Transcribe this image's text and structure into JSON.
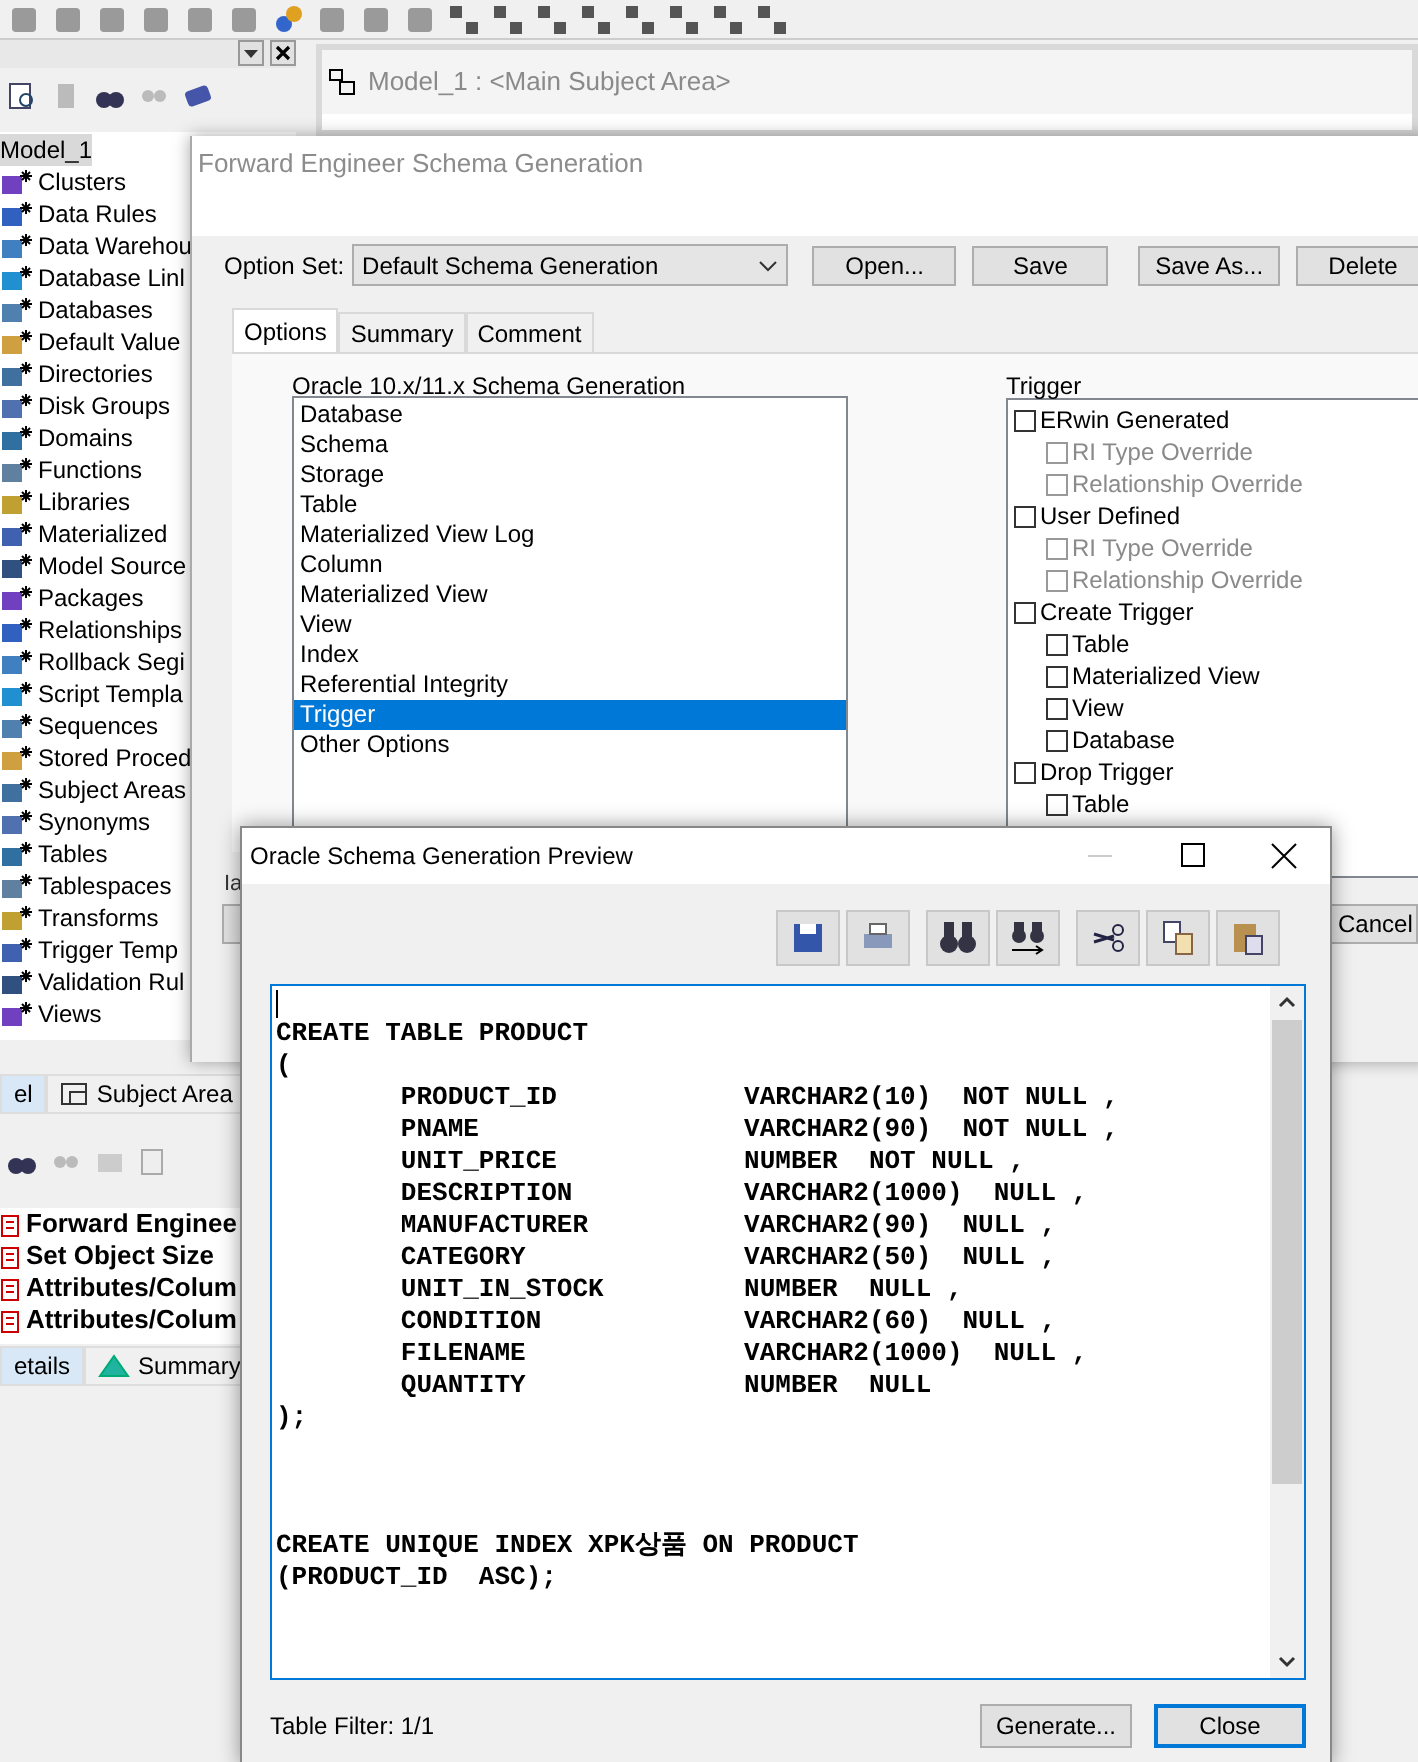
{
  "model_explorer": {
    "root": {
      "label": "Model_1",
      "selected": true
    },
    "items": [
      {
        "label": "Clusters",
        "selected": false
      },
      {
        "label": "Data Rules",
        "selected": false
      },
      {
        "label": "Data Warehou",
        "selected": false
      },
      {
        "label": "Database Linl",
        "selected": false
      },
      {
        "label": "Databases",
        "selected": false
      },
      {
        "label": "Default Value",
        "selected": false
      },
      {
        "label": "Directories",
        "selected": false
      },
      {
        "label": "Disk Groups",
        "selected": false
      },
      {
        "label": "Domains",
        "selected": false
      },
      {
        "label": "Functions",
        "selected": false
      },
      {
        "label": "Libraries",
        "selected": false
      },
      {
        "label": "Materialized",
        "selected": false
      },
      {
        "label": "Model Source",
        "selected": false
      },
      {
        "label": "Packages",
        "selected": false
      },
      {
        "label": "Relationships",
        "selected": false
      },
      {
        "label": "Rollback Segi",
        "selected": false
      },
      {
        "label": "Script Templa",
        "selected": false
      },
      {
        "label": "Sequences",
        "selected": false
      },
      {
        "label": "Stored Proced",
        "selected": false
      },
      {
        "label": "Subject Areas",
        "selected": false
      },
      {
        "label": "Synonyms",
        "selected": false
      },
      {
        "label": "Tables",
        "selected": false
      },
      {
        "label": "Tablespaces",
        "selected": false
      },
      {
        "label": "Transforms",
        "selected": false
      },
      {
        "label": "Trigger Temp",
        "selected": false
      },
      {
        "label": "Validation Rul",
        "selected": false
      },
      {
        "label": "Views",
        "selected": false
      }
    ]
  },
  "model_window": {
    "title": "Model_1 : <Main Subject Area>"
  },
  "explorer_tabs": [
    {
      "label": "el",
      "selected": true
    },
    {
      "label": "Subject Area",
      "selected": false
    }
  ],
  "action_log": {
    "items": [
      "Forward Enginee",
      "Set Object Size",
      "Attributes/Colum",
      "Attributes/Colum"
    ]
  },
  "log_tabs": [
    {
      "label": "etails",
      "selected": true
    },
    {
      "label": "Summary",
      "selected": false
    }
  ],
  "forward_engineer": {
    "title": "Forward Engineer Schema Generation",
    "option_set_label": "Option Set:",
    "option_set": "Default Schema Generation",
    "buttons": [
      "Open...",
      "Save",
      "Save As...",
      "Delete"
    ],
    "tabs": [
      {
        "label": "Options",
        "selected": true
      },
      {
        "label": "Summary",
        "selected": false
      },
      {
        "label": "Comment",
        "selected": false
      }
    ],
    "schema_label": "Oracle 10.x/11.x Schema Generation",
    "categories": [
      {
        "label": "Database",
        "selected": false
      },
      {
        "label": "Schema",
        "selected": false
      },
      {
        "label": "Storage",
        "selected": false
      },
      {
        "label": "Table",
        "selected": false
      },
      {
        "label": "Materialized View Log",
        "selected": false
      },
      {
        "label": "Column",
        "selected": false
      },
      {
        "label": "Materialized View",
        "selected": false
      },
      {
        "label": "View",
        "selected": false
      },
      {
        "label": "Index",
        "selected": false
      },
      {
        "label": "Referential Integrity",
        "selected": false
      },
      {
        "label": "Trigger",
        "selected": true
      },
      {
        "label": "Other Options",
        "selected": false
      }
    ],
    "trigger_label": "Trigger",
    "trigger_options": [
      {
        "label": "ERwin Generated",
        "checked": false,
        "disabled": false,
        "children": [
          {
            "label": "RI Type Override",
            "checked": false,
            "disabled": true
          },
          {
            "label": "Relationship Override",
            "checked": false,
            "disabled": true
          }
        ]
      },
      {
        "label": "User Defined",
        "checked": false,
        "disabled": false,
        "children": [
          {
            "label": "RI Type Override",
            "checked": false,
            "disabled": true
          },
          {
            "label": "Relationship Override",
            "checked": false,
            "disabled": true
          }
        ]
      },
      {
        "label": "Create Trigger",
        "checked": false,
        "disabled": false,
        "children": [
          {
            "label": "Table",
            "checked": false,
            "disabled": false
          },
          {
            "label": "Materialized View",
            "checked": false,
            "disabled": false
          },
          {
            "label": "View",
            "checked": false,
            "disabled": false
          },
          {
            "label": "Database",
            "checked": false,
            "disabled": false
          }
        ]
      },
      {
        "label": "Drop Trigger",
        "checked": false,
        "disabled": false,
        "children": [
          {
            "label": "Table",
            "checked": false,
            "disabled": false
          }
        ]
      }
    ],
    "cut_label": "Ia",
    "cancel": "Cancel"
  },
  "preview": {
    "title": "Oracle Schema Generation Preview",
    "statements": [
      [
        "CREATE TABLE PRODUCT",
        "(",
        "        PRODUCT_ID            VARCHAR2(10)  NOT NULL ,",
        "        PNAME                 VARCHAR2(90)  NOT NULL ,",
        "        UNIT_PRICE            NUMBER  NOT NULL ,",
        "        DESCRIPTION           VARCHAR2(1000)  NULL ,",
        "        MANUFACTURER          VARCHAR2(90)  NULL ,",
        "        CATEGORY              VARCHAR2(50)  NULL ,",
        "        UNIT_IN_STOCK         NUMBER  NULL ,",
        "        CONDITION             VARCHAR2(60)  NULL ,",
        "        FILENAME              VARCHAR2(1000)  NULL ,",
        "        QUANTITY              NUMBER  NULL",
        ");"
      ],
      [
        "CREATE UNIQUE INDEX XPK상품 ON PRODUCT",
        "(PRODUCT_ID  ASC);"
      ]
    ],
    "status": "Table Filter: 1/1",
    "buttons": [
      {
        "label": "Generate...",
        "default": false
      },
      {
        "label": "Close",
        "default": true
      }
    ]
  }
}
